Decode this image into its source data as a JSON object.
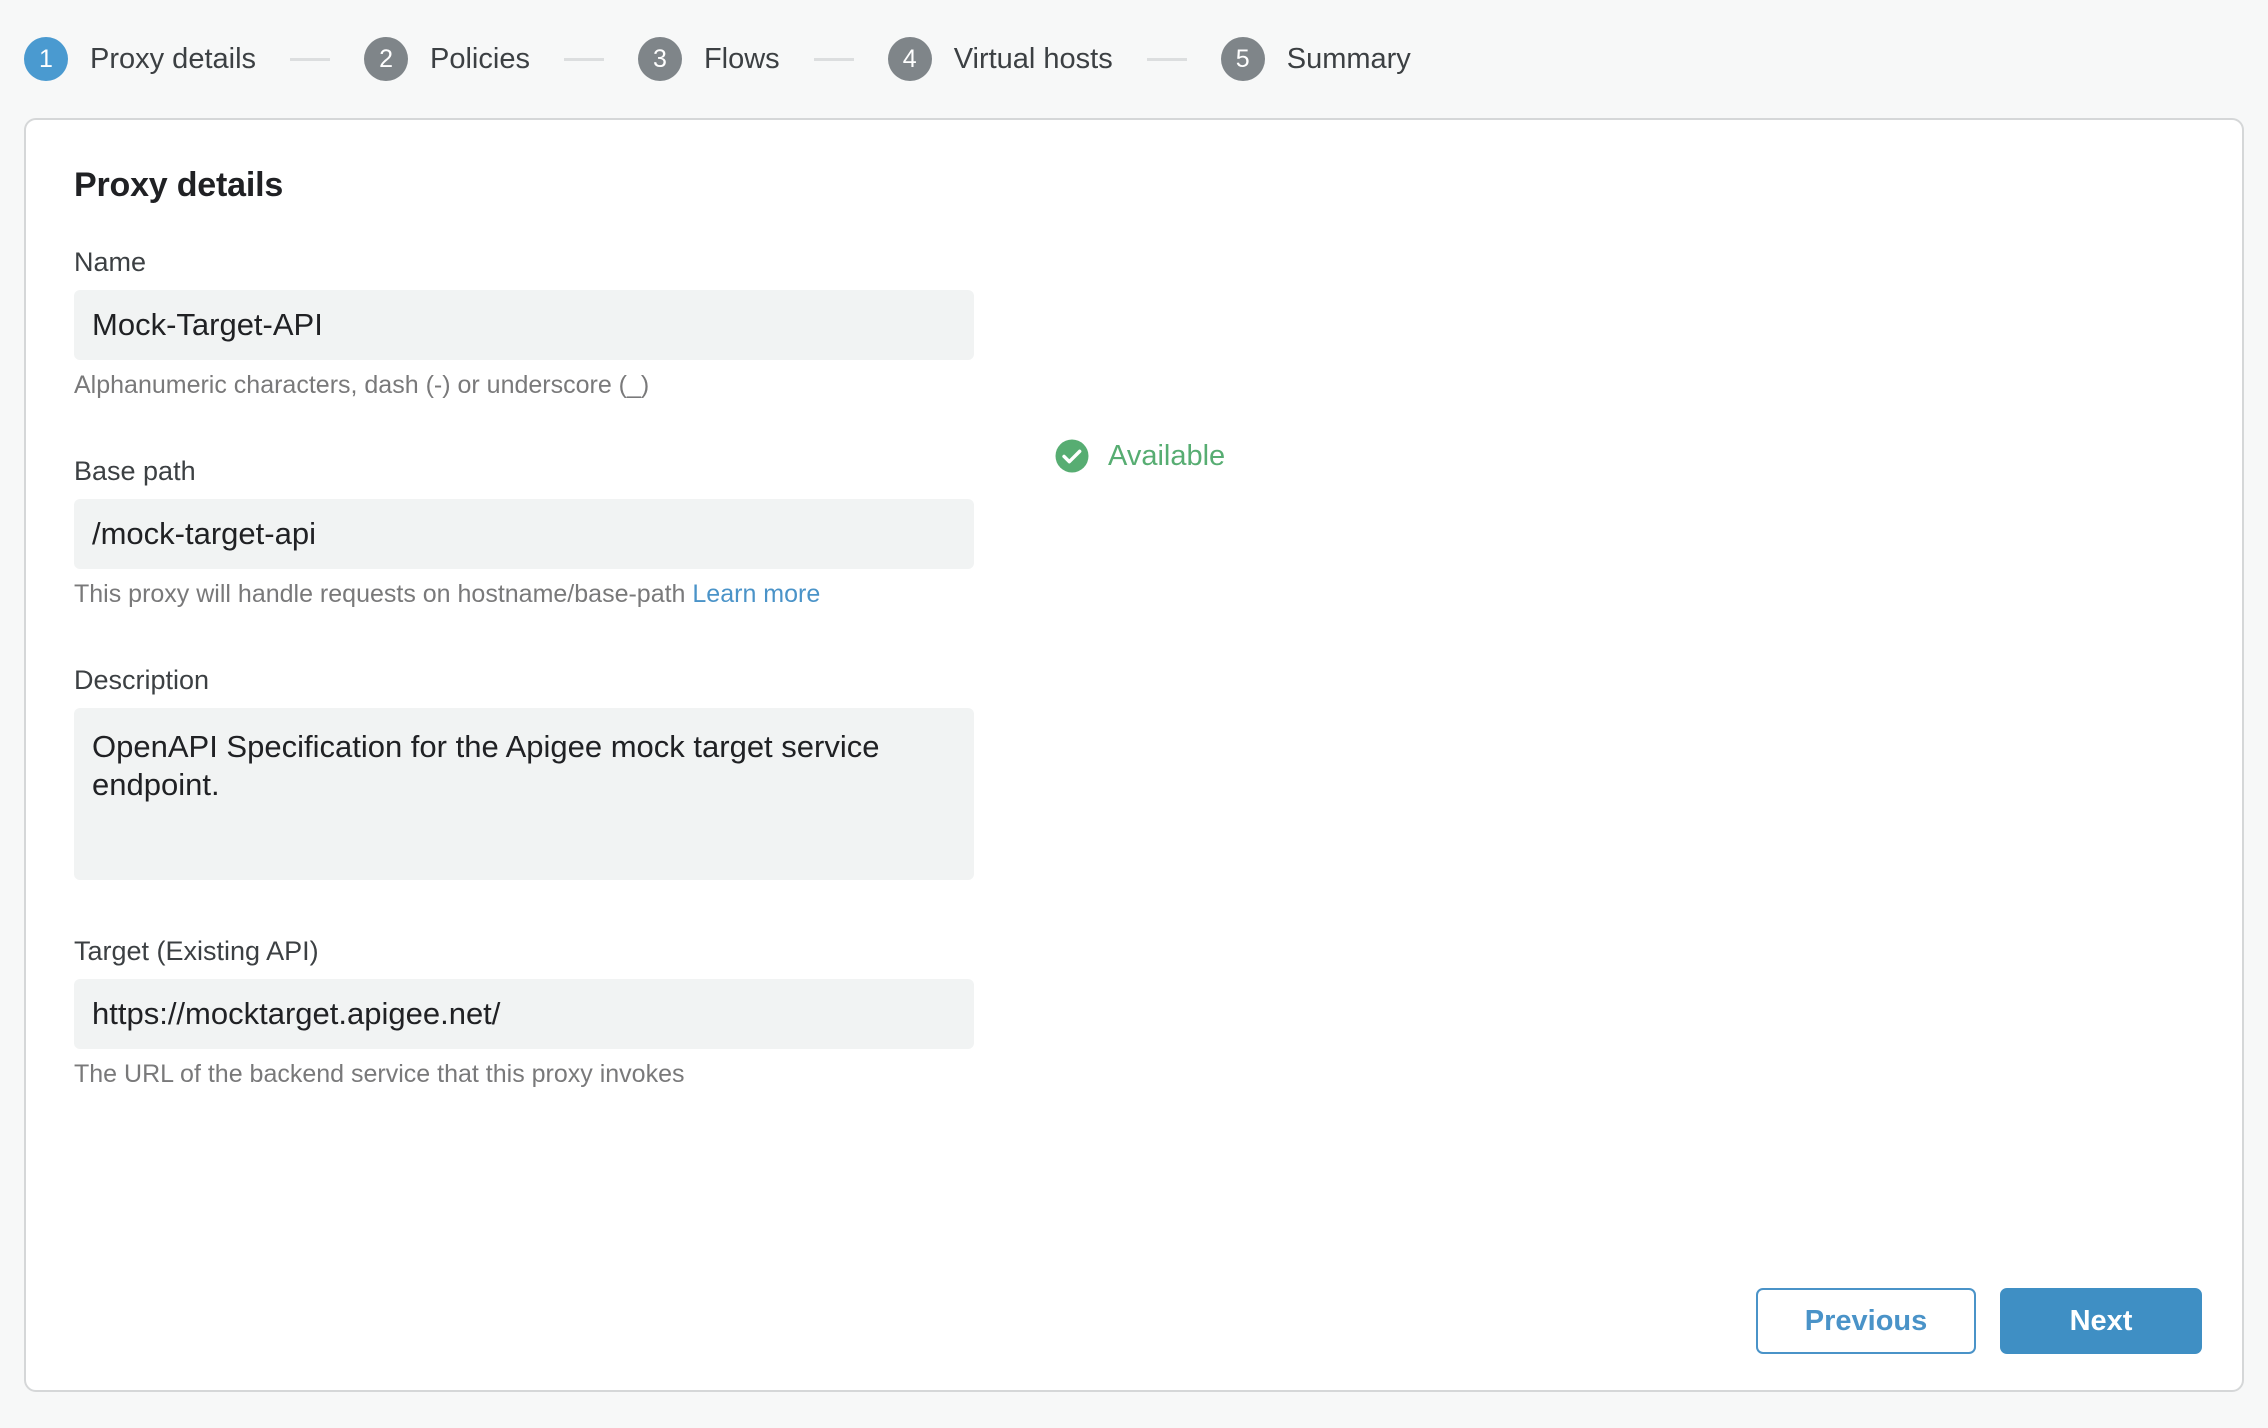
{
  "stepper": {
    "steps": [
      {
        "number": "1",
        "label": "Proxy details",
        "state": "active"
      },
      {
        "number": "2",
        "label": "Policies",
        "state": "inactive"
      },
      {
        "number": "3",
        "label": "Flows",
        "state": "inactive"
      },
      {
        "number": "4",
        "label": "Virtual hosts",
        "state": "inactive"
      },
      {
        "number": "5",
        "label": "Summary",
        "state": "inactive"
      }
    ]
  },
  "card": {
    "title": "Proxy details",
    "fields": {
      "name": {
        "label": "Name",
        "value": "Mock-Target-API",
        "help": "Alphanumeric characters, dash (-) or underscore (_)"
      },
      "base_path": {
        "label": "Base path",
        "value": "/mock-target-api",
        "help_text": "This proxy will handle requests on hostname/base-path",
        "help_link": "Learn more"
      },
      "description": {
        "label": "Description",
        "value": "OpenAPI Specification for the Apigee mock target service endpoint."
      },
      "target": {
        "label": "Target (Existing API)",
        "value": "https://mocktarget.apigee.net/",
        "help": "The URL of the backend service that this proxy invokes"
      }
    },
    "availability": {
      "icon": "check-circle-icon",
      "text": "Available"
    },
    "buttons": {
      "previous": "Previous",
      "next": "Next"
    }
  },
  "colors": {
    "accent_blue": "#4a9ad0",
    "primary_button": "#3f8fc4",
    "link_blue": "#4a93c8",
    "success_green": "#57ad72",
    "step_inactive": "#7f8589",
    "field_background": "#f1f3f3",
    "page_background": "#f7f8f8"
  }
}
